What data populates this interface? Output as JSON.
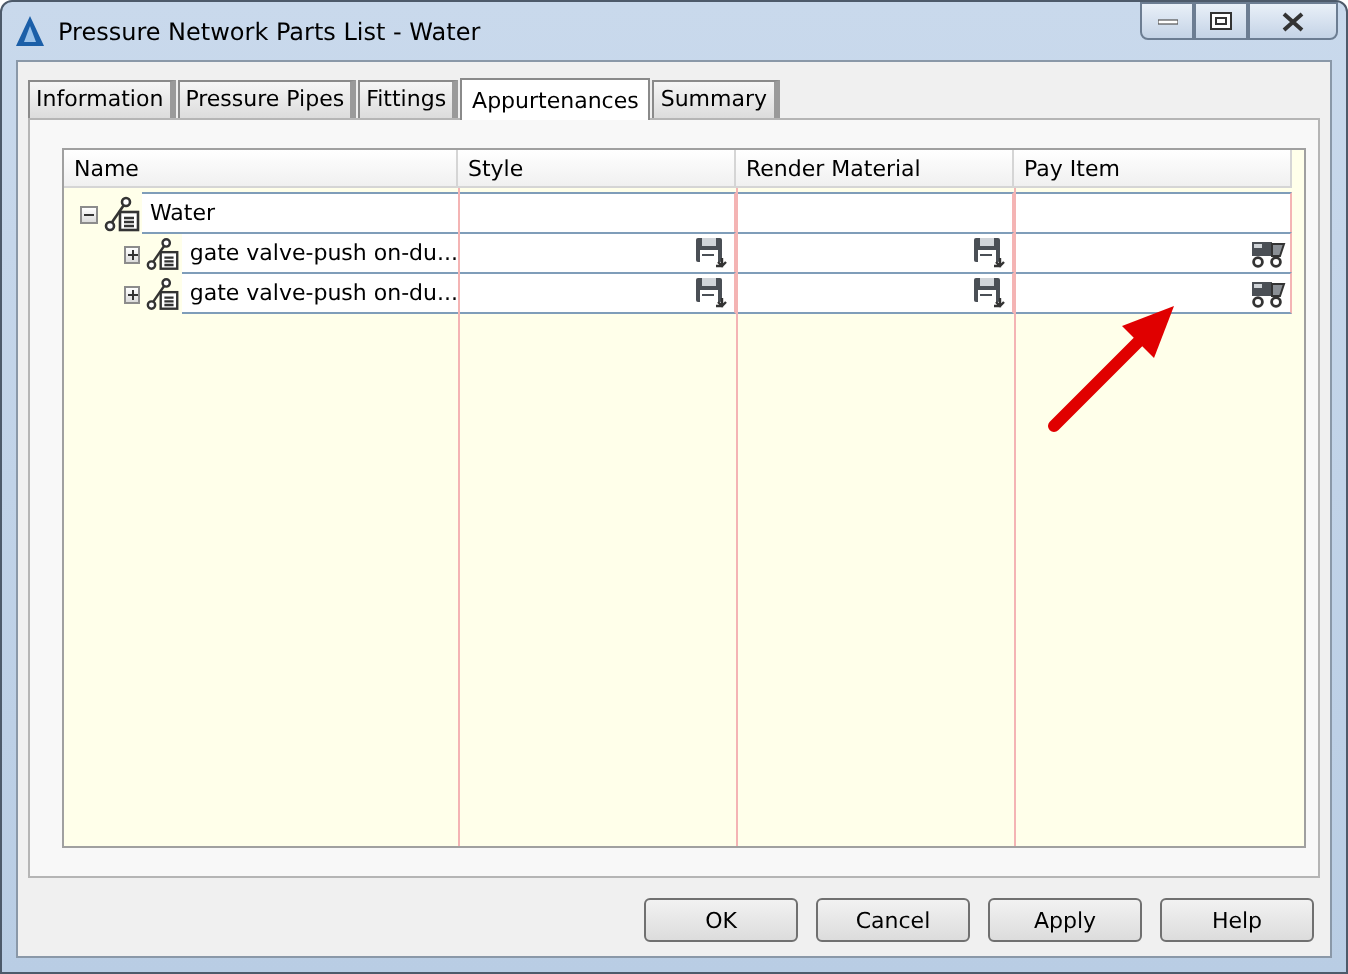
{
  "window": {
    "title": "Pressure Network Parts List - Water"
  },
  "tabs": [
    {
      "label": "Information",
      "selected": false
    },
    {
      "label": "Pressure Pipes",
      "selected": false
    },
    {
      "label": "Fittings",
      "selected": false
    },
    {
      "label": "Appurtenances",
      "selected": true
    },
    {
      "label": "Summary",
      "selected": false
    }
  ],
  "table": {
    "columns": [
      "Name",
      "Style",
      "Render Material",
      "Pay Item"
    ],
    "rows": [
      {
        "name": "Water",
        "expanded": true,
        "children": [
          {
            "name": "gate valve-push on-du...",
            "expanded": false
          },
          {
            "name": "gate valve-push on-du...",
            "expanded": false
          }
        ]
      }
    ]
  },
  "buttons": [
    "OK",
    "Cancel",
    "Apply",
    "Help"
  ]
}
